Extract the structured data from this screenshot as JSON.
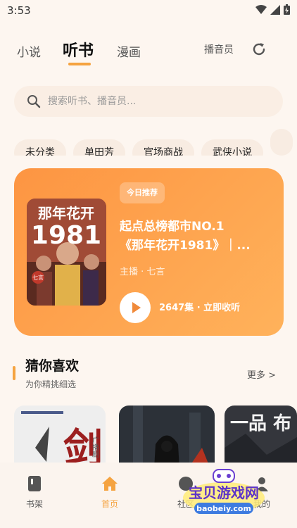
{
  "status": {
    "time": "3:53"
  },
  "tabs": [
    {
      "label": "小说"
    },
    {
      "label": "听书"
    },
    {
      "label": "漫画"
    }
  ],
  "header": {
    "narrator": "播音员"
  },
  "search": {
    "placeholder": "搜索听书、播音员..."
  },
  "chips": [
    "未分类",
    "单田芳",
    "官场商战",
    "武侠小说"
  ],
  "recommend": {
    "badge": "今日推荐",
    "title_line1": "起点总榜都市NO.1",
    "title_line2": "《那年花开1981》｜...",
    "host": "主播 · 七言",
    "episodes": "2647集 · 立即收听",
    "cover_text_top": "那年花开",
    "cover_text_year": "1981",
    "cover_stamp": "七言"
  },
  "guess": {
    "title": "猜你喜欢",
    "subtitle": "为你精挑细选",
    "more": "更多 >"
  },
  "books": [
    {
      "cover_text": "剑",
      "side_text": "广播剧"
    },
    {
      "cover_text": ""
    },
    {
      "cover_text": "一品 布"
    }
  ],
  "nav": [
    {
      "label": "书架",
      "icon": "book-icon"
    },
    {
      "label": "首页",
      "icon": "home-icon"
    },
    {
      "label": "社区",
      "icon": "community-icon"
    },
    {
      "label": "我的",
      "icon": "profile-icon"
    }
  ],
  "watermark": {
    "cn": "宝贝游戏网",
    "en": "baobeiy.com"
  },
  "colors": {
    "accent": "#f5a340",
    "card_start": "#fd9542",
    "card_end": "#ffb25b",
    "background": "#fdf6f0"
  }
}
